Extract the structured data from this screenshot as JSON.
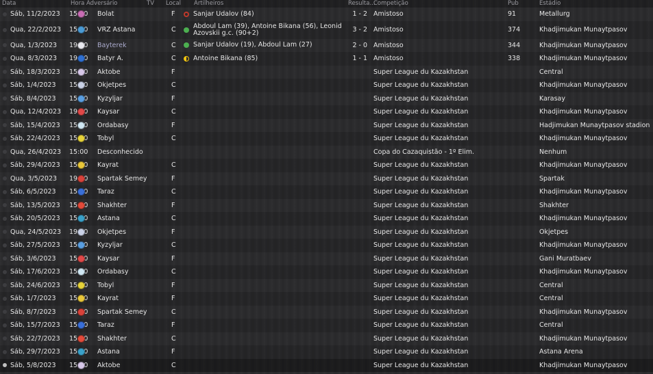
{
  "headers": {
    "date": "Data",
    "time_opp": "Hora Adversário",
    "tv": "TV",
    "local": "Local",
    "scorers": "Artilheiros",
    "result": "Resulta...",
    "competition": "Competição",
    "pub": "Pub",
    "stadium": "Estádio"
  },
  "rows": [
    {
      "date": "Sáb, 11/2/2023",
      "time": "15:00",
      "opponent": "Bolat",
      "crest": "#c86db4",
      "local": "F",
      "scorers": "Sanjar Udalov (84)",
      "outcome": "loss",
      "result": "1 - 2",
      "competition": "Amistoso",
      "pub": "91",
      "stadium": "Metallurg"
    },
    {
      "date": "Qua, 22/2/2023",
      "time": "15:00",
      "opponent": "VRZ Astana",
      "crest": "#4a9ad4",
      "local": "C",
      "scorers": "Abdoul Lam (39), Antoine Bikana (56), Leonid Azovskii g.c. (90+2)",
      "outcome": "win",
      "result": "3 - 2",
      "competition": "Amistoso",
      "pub": "374",
      "stadium": "Khadjimukan Munaytpasov",
      "tall": true
    },
    {
      "date": "Qua, 1/3/2023",
      "time": "19:30",
      "opponent": "Bayterek",
      "crest": "#e8e8ee",
      "local": "C",
      "scorers": "Sanjar Udalov (19), Abdoul Lam (27)",
      "outcome": "win",
      "result": "2 - 0",
      "competition": "Amistoso",
      "pub": "344",
      "stadium": "Khadjimukan Munaytpasov",
      "muted": true
    },
    {
      "date": "Qua, 8/3/2023",
      "time": "19:30",
      "opponent": "Batyr A.",
      "crest": "#2f6fd0",
      "local": "C",
      "scorers": "Antoine Bikana (85)",
      "outcome": "draw",
      "result": "1 - 1",
      "competition": "Amistoso",
      "pub": "338",
      "stadium": "Khadjimukan Munaytpasov"
    },
    {
      "date": "Sáb, 18/3/2023",
      "time": "15:00",
      "opponent": "Aktobe",
      "crest": "#d6c7e8",
      "local": "F",
      "scorers": "",
      "outcome": "",
      "result": "",
      "competition": "Super League du Kazakhstan",
      "pub": "",
      "stadium": "Central"
    },
    {
      "date": "Sáb, 1/4/2023",
      "time": "15:00",
      "opponent": "Okjetpes",
      "crest": "#c9d1e6",
      "local": "C",
      "scorers": "",
      "outcome": "",
      "result": "",
      "competition": "Super League du Kazakhstan",
      "pub": "",
      "stadium": "Khadjimukan Munaytpasov"
    },
    {
      "date": "Sáb, 8/4/2023",
      "time": "15:00",
      "opponent": "Kyzyljar",
      "crest": "#5a9ee0",
      "local": "F",
      "scorers": "",
      "outcome": "",
      "result": "",
      "competition": "Super League du Kazakhstan",
      "pub": "",
      "stadium": "Karasay"
    },
    {
      "date": "Qua, 12/4/2023",
      "time": "19:30",
      "opponent": "Kaysar",
      "crest": "#e04848",
      "local": "C",
      "scorers": "",
      "outcome": "",
      "result": "",
      "competition": "Super League du Kazakhstan",
      "pub": "",
      "stadium": "Khadjimukan Munaytpasov"
    },
    {
      "date": "Sáb, 15/4/2023",
      "time": "15:00",
      "opponent": "Ordabasy",
      "crest": "#cfe6f2",
      "local": "F",
      "scorers": "",
      "outcome": "",
      "result": "",
      "competition": "Super League du Kazakhstan",
      "pub": "",
      "stadium": "Hadjimukan Munaytpasov stadion"
    },
    {
      "date": "Sáb, 22/4/2023",
      "time": "15:00",
      "opponent": "Tobyl",
      "crest": "#e6d23a",
      "local": "C",
      "scorers": "",
      "outcome": "",
      "result": "",
      "competition": "Super League du Kazakhstan",
      "pub": "",
      "stadium": "Khadjimukan Munaytpasov"
    },
    {
      "date": "Qua, 26/4/2023",
      "time": "15:00",
      "opponent": "Desconhecido",
      "crest": "",
      "local": "",
      "scorers": "",
      "outcome": "",
      "result": "",
      "competition": "Copa do Cazaquistão - 1º Elim.",
      "pub": "",
      "stadium": "Nenhum"
    },
    {
      "date": "Sáb, 29/4/2023",
      "time": "15:00",
      "opponent": "Kayrat",
      "crest": "#e8c63a",
      "local": "C",
      "scorers": "",
      "outcome": "",
      "result": "",
      "competition": "Super League du Kazakhstan",
      "pub": "",
      "stadium": "Khadjimukan Munaytpasov"
    },
    {
      "date": "Qua, 3/5/2023",
      "time": "19:30",
      "opponent": "Spartak Semey",
      "crest": "#d8423a",
      "local": "F",
      "scorers": "",
      "outcome": "",
      "result": "",
      "competition": "Super League du Kazakhstan",
      "pub": "",
      "stadium": "Spartak"
    },
    {
      "date": "Sáb, 6/5/2023",
      "time": "15:00",
      "opponent": "Taraz",
      "crest": "#3a6fd8",
      "local": "C",
      "scorers": "",
      "outcome": "",
      "result": "",
      "competition": "Super League du Kazakhstan",
      "pub": "",
      "stadium": "Khadjimukan Munaytpasov"
    },
    {
      "date": "Sáb, 13/5/2023",
      "time": "15:00",
      "opponent": "Shakhter",
      "crest": "#e24a3a",
      "local": "F",
      "scorers": "",
      "outcome": "",
      "result": "",
      "competition": "Super League du Kazakhstan",
      "pub": "",
      "stadium": "Shakhter"
    },
    {
      "date": "Sáb, 20/5/2023",
      "time": "15:00",
      "opponent": "Astana",
      "crest": "#3aa0c8",
      "local": "C",
      "scorers": "",
      "outcome": "",
      "result": "",
      "competition": "Super League du Kazakhstan",
      "pub": "",
      "stadium": "Khadjimukan Munaytpasov"
    },
    {
      "date": "Qua, 24/5/2023",
      "time": "19:30",
      "opponent": "Okjetpes",
      "crest": "#c9d1e6",
      "local": "F",
      "scorers": "",
      "outcome": "",
      "result": "",
      "competition": "Super League du Kazakhstan",
      "pub": "",
      "stadium": "Okjetpes"
    },
    {
      "date": "Sáb, 27/5/2023",
      "time": "15:00",
      "opponent": "Kyzyljar",
      "crest": "#5a9ee0",
      "local": "C",
      "scorers": "",
      "outcome": "",
      "result": "",
      "competition": "Super League du Kazakhstan",
      "pub": "",
      "stadium": "Khadjimukan Munaytpasov"
    },
    {
      "date": "Sáb, 3/6/2023",
      "time": "15:00",
      "opponent": "Kaysar",
      "crest": "#e04848",
      "local": "F",
      "scorers": "",
      "outcome": "",
      "result": "",
      "competition": "Super League du Kazakhstan",
      "pub": "",
      "stadium": "Gani Muratbaev"
    },
    {
      "date": "Sáb, 17/6/2023",
      "time": "15:00",
      "opponent": "Ordabasy",
      "crest": "#cfe6f2",
      "local": "C",
      "scorers": "",
      "outcome": "",
      "result": "",
      "competition": "Super League du Kazakhstan",
      "pub": "",
      "stadium": "Khadjimukan Munaytpasov"
    },
    {
      "date": "Sáb, 24/6/2023",
      "time": "15:00",
      "opponent": "Tobyl",
      "crest": "#e6d23a",
      "local": "F",
      "scorers": "",
      "outcome": "",
      "result": "",
      "competition": "Super League du Kazakhstan",
      "pub": "",
      "stadium": "Central"
    },
    {
      "date": "Sáb, 1/7/2023",
      "time": "15:00",
      "opponent": "Kayrat",
      "crest": "#e8c63a",
      "local": "F",
      "scorers": "",
      "outcome": "",
      "result": "",
      "competition": "Super League du Kazakhstan",
      "pub": "",
      "stadium": "Central"
    },
    {
      "date": "Sáb, 8/7/2023",
      "time": "15:00",
      "opponent": "Spartak Semey",
      "crest": "#d8423a",
      "local": "C",
      "scorers": "",
      "outcome": "",
      "result": "",
      "competition": "Super League du Kazakhstan",
      "pub": "",
      "stadium": "Khadjimukan Munaytpasov"
    },
    {
      "date": "Sáb, 15/7/2023",
      "time": "15:00",
      "opponent": "Taraz",
      "crest": "#3a6fd8",
      "local": "F",
      "scorers": "",
      "outcome": "",
      "result": "",
      "competition": "Super League du Kazakhstan",
      "pub": "",
      "stadium": "Central"
    },
    {
      "date": "Sáb, 22/7/2023",
      "time": "15:00",
      "opponent": "Shakhter",
      "crest": "#e24a3a",
      "local": "C",
      "scorers": "",
      "outcome": "",
      "result": "",
      "competition": "Super League du Kazakhstan",
      "pub": "",
      "stadium": "Khadjimukan Munaytpasov"
    },
    {
      "date": "Sáb, 29/7/2023",
      "time": "15:00",
      "opponent": "Astana",
      "crest": "#3aa0c8",
      "local": "F",
      "scorers": "",
      "outcome": "",
      "result": "",
      "competition": "Super League du Kazakhstan",
      "pub": "",
      "stadium": "Astana Arena"
    },
    {
      "date": "Sáb, 5/8/2023",
      "time": "15:00",
      "opponent": "Aktobe",
      "crest": "#d6c7e8",
      "local": "C",
      "scorers": "",
      "outcome": "",
      "result": "",
      "competition": "Super League du Kazakhstan",
      "pub": "",
      "stadium": "Khadjimukan Munaytpasov",
      "selected": true
    }
  ]
}
